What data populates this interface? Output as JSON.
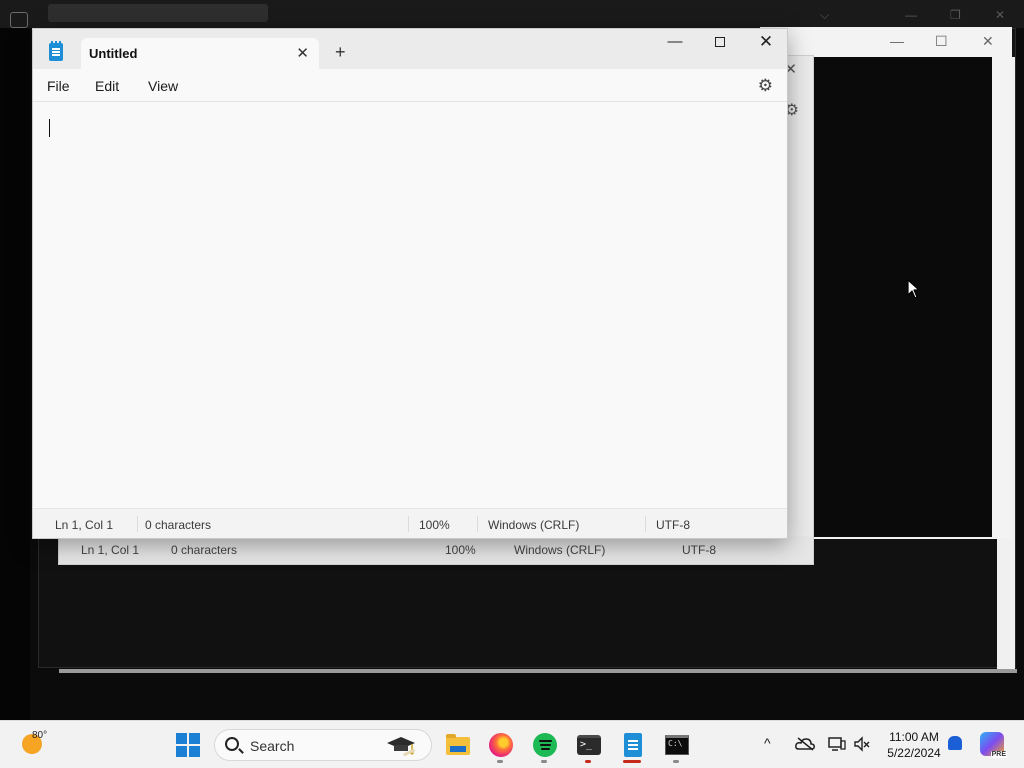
{
  "notepad": {
    "tab_title": "Untitled",
    "tab_close": "✕",
    "new_tab": "+",
    "window_controls": {
      "minimize": "—",
      "close": "✕"
    },
    "menu": [
      {
        "label": "File"
      },
      {
        "label": "Edit"
      },
      {
        "label": "View"
      }
    ],
    "settings_icon": "⚙",
    "status": {
      "position": "Ln 1, Col 1",
      "characters": "0 characters",
      "zoom": "100%",
      "line_endings": "Windows (CRLF)",
      "encoding": "UTF-8"
    }
  },
  "background_notepad": {
    "status": {
      "position": "Ln 1, Col 1",
      "characters": "0 characters",
      "zoom": "100%",
      "line_endings": "Windows (CRLF)",
      "encoding": "UTF-8"
    }
  },
  "taskbar": {
    "weather_temp": "80°",
    "search_label": "Search",
    "apps": [
      {
        "name": "file-explorer-icon"
      },
      {
        "name": "firefox-icon"
      },
      {
        "name": "spotify-icon"
      },
      {
        "name": "terminal-icon"
      },
      {
        "name": "notepad-icon"
      },
      {
        "name": "command-prompt-icon"
      }
    ],
    "clock": {
      "time": "11:00 AM",
      "date": "5/22/2024"
    },
    "copilot_badge": "PRE",
    "tray_chevron": "^"
  },
  "colors": {
    "accent": "#1b7fd4",
    "notepad_bg": "#f9f9f9",
    "titlebar_bg": "#ebebeb",
    "desktop_bg": "#0b0b0b"
  }
}
